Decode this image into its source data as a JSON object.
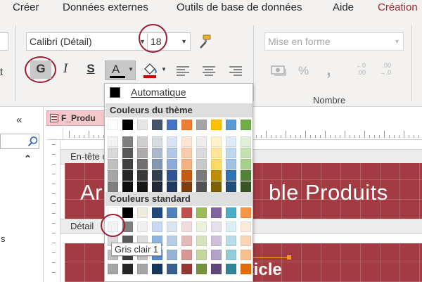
{
  "tabs": [
    "Créer",
    "Données externes",
    "Outils de base de données",
    "Aide",
    "Création"
  ],
  "font": {
    "name": "Calibri (Détail)",
    "size": "18",
    "bold_label": "G",
    "italic_label": "I",
    "underline_label": "S",
    "font_color_label": "A"
  },
  "number": {
    "format_placeholder": "Mise en forme",
    "group_label": "Nombre",
    "percent": "%",
    "comma": ",",
    "inc_decimals_top": "←0",
    "inc_decimals_bottom": ".00",
    "dec_decimals_top": ".00",
    "dec_decimals_bottom": "→.0"
  },
  "left_stub": "t",
  "navpane": {
    "collapse": "«",
    "expand": "⌃",
    "search_icon": "search-icon",
    "stub_text": "s"
  },
  "document": {
    "tab_label": "F_Produ"
  },
  "sections": {
    "header_label": "En-tête c",
    "detail_label": "Détail"
  },
  "form": {
    "title_visible": "Ar",
    "title_visible_right": "ble Produits",
    "detail_visible": "article"
  },
  "colormenu": {
    "auto_label": "Automatique",
    "auto_color": "#000000",
    "theme_heading": "Couleurs du thème",
    "standard_heading": "Couleurs standard",
    "tooltip": "Gris clair 1",
    "theme_top_row": [
      "#ffffff",
      "#000000",
      "#e7e6e6",
      "#44546a",
      "#4472c4",
      "#ed7d31",
      "#a5a5a5",
      "#ffc000",
      "#5b9bd5",
      "#70ad47"
    ],
    "theme_shades": [
      [
        "#f2f2f2",
        "#7f7f7f",
        "#d0cece",
        "#d6dce4",
        "#d9e2f3",
        "#fbe5d5",
        "#ededed",
        "#fff2cc",
        "#deebf6",
        "#e2efd9"
      ],
      [
        "#d8d8d8",
        "#595959",
        "#aeaaaa",
        "#adb9ca",
        "#b4c6e7",
        "#f7cbac",
        "#dbdbdb",
        "#fee599",
        "#bdd7ee",
        "#c5e0b3"
      ],
      [
        "#bfbfbf",
        "#3f3f3f",
        "#757070",
        "#8496b0",
        "#8eaadb",
        "#f4b183",
        "#c9c9c9",
        "#ffd965",
        "#9cc3e5",
        "#a8d08d"
      ],
      [
        "#a5a5a5",
        "#262626",
        "#3a3838",
        "#323f4f",
        "#2f5496",
        "#c55a11",
        "#7b7b7b",
        "#bf8f00",
        "#2e75b5",
        "#538135"
      ],
      [
        "#7f7f7f",
        "#0c0c0c",
        "#171616",
        "#222a35",
        "#1f3864",
        "#833c0b",
        "#525252",
        "#7f6000",
        "#1e4e79",
        "#375623"
      ]
    ],
    "standard_row1": [
      "#ffffff",
      "#000000",
      "#eeece1",
      "#1f497d",
      "#4f81bd",
      "#c0504d",
      "#9bbb59",
      "#8064a2",
      "#4bacc6",
      "#f79646"
    ],
    "standard_rows": [
      [
        "#f2f2f2",
        "#808080",
        "#f0f0f0",
        "#c6d9f0",
        "#dbe5f1",
        "#f2dcdb",
        "#ebf1dd",
        "#e5e0ec",
        "#dbeef3",
        "#fdeada"
      ],
      [
        "#d8d8d8",
        "#595959",
        "#dddddd",
        "#8db3e2",
        "#b8cce4",
        "#e5b9b7",
        "#d7e3bc",
        "#ccc1d9",
        "#b7dde8",
        "#fbd5b5"
      ],
      [
        "#bfbfbf",
        "#3f3f3f",
        "#c3c3c3",
        "#548dd4",
        "#95b3d7",
        "#d99694",
        "#c3d69b",
        "#b2a2c7",
        "#92cddc",
        "#fac08f"
      ],
      [
        "#a5a5a5",
        "#262626",
        "#a5a5a5",
        "#17365d",
        "#366092",
        "#953734",
        "#76923c",
        "#5f497a",
        "#31859b",
        "#e36c09"
      ]
    ]
  }
}
